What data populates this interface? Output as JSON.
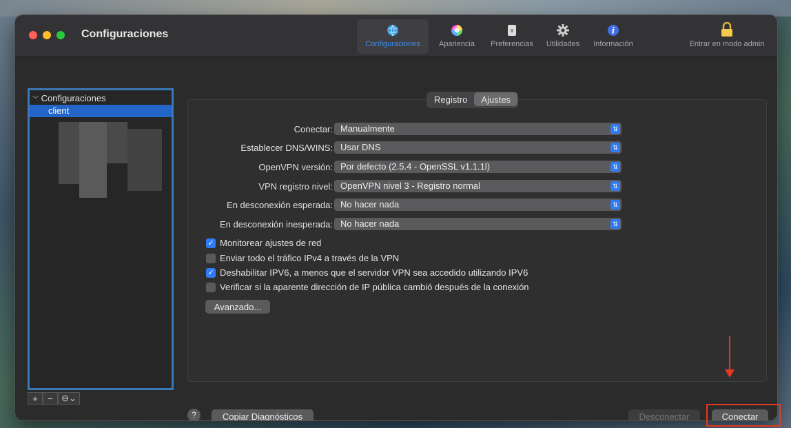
{
  "window": {
    "title": "Configuraciones"
  },
  "toolbar": {
    "items": [
      {
        "label": "Configuraciones",
        "icon": "globe-icon"
      },
      {
        "label": "Apariencia",
        "icon": "color-wheel-icon"
      },
      {
        "label": "Preferencias",
        "icon": "switch-icon"
      },
      {
        "label": "Utilidades",
        "icon": "gear-icon"
      },
      {
        "label": "Información",
        "icon": "info-icon"
      }
    ],
    "admin_label": "Entrar en modo admin"
  },
  "sidebar": {
    "header": "Configuraciones",
    "selected": "client",
    "tools": [
      "+",
      "−",
      "⊖⌄"
    ]
  },
  "tabs": [
    "Registro",
    "Ajustes"
  ],
  "settings": [
    {
      "label": "Conectar:",
      "value": "Manualmente"
    },
    {
      "label": "Establecer DNS/WINS:",
      "value": "Usar DNS"
    },
    {
      "label": "OpenVPN versión:",
      "value": "Por defecto (2.5.4 - OpenSSL v1.1.1l)"
    },
    {
      "label": "VPN registro nivel:",
      "value": "OpenVPN nivel 3 - Registro normal"
    },
    {
      "label": "En desconexión esperada:",
      "value": "No hacer nada"
    },
    {
      "label": "En desconexión inesperada:",
      "value": "No hacer nada"
    }
  ],
  "checkboxes": [
    {
      "label": "Monitorear ajustes de red",
      "checked": true
    },
    {
      "label": "Enviar todo el tráfico IPv4 a través de la VPN",
      "checked": false
    },
    {
      "label": "Deshabilitar IPV6, a menos que el servidor VPN sea accedido utilizando IPV6",
      "checked": true
    },
    {
      "label": "Verificar si la aparente dirección de IP pública cambió después de la conexión",
      "checked": false
    }
  ],
  "buttons": {
    "advanced": "Avanzado...",
    "help": "?",
    "copy_diagnostics": "Copiar Diagnósticos",
    "disconnect": "Desconectar",
    "connect": "Conectar"
  },
  "colors": {
    "accent": "#2f7cf6",
    "annotation": "#e5391f"
  }
}
